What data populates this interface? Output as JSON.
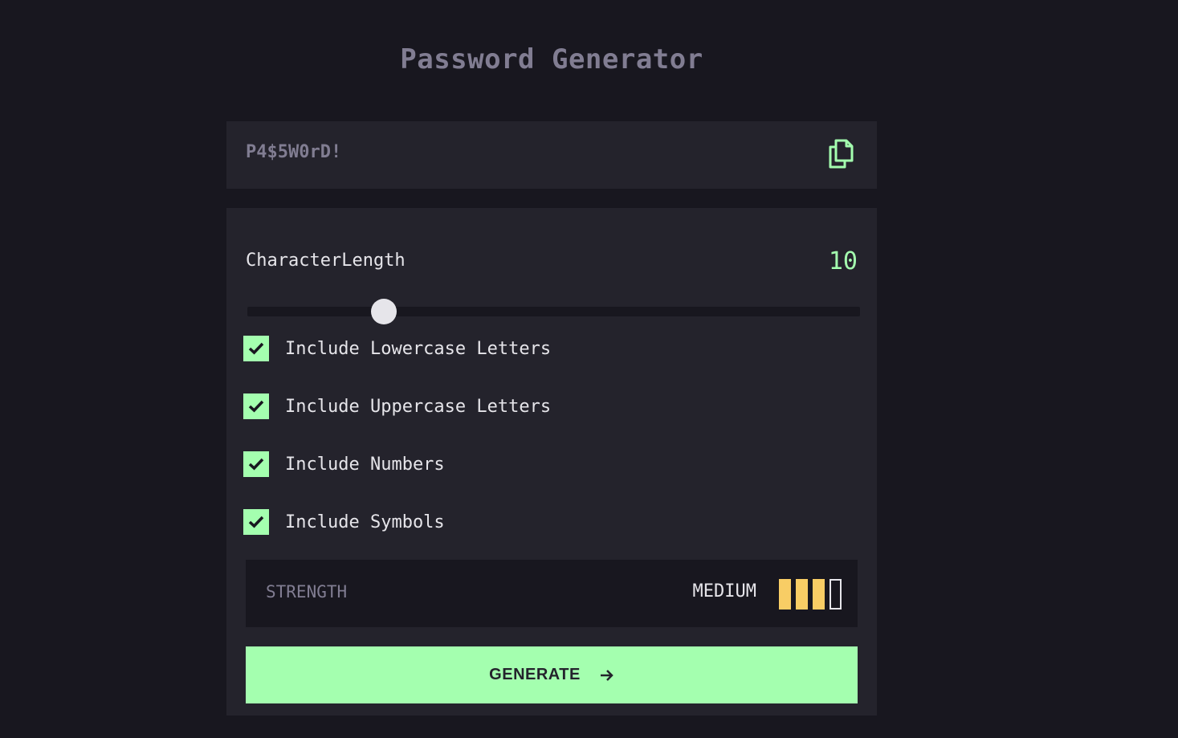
{
  "app": {
    "title": "Password Generator"
  },
  "output": {
    "password": "P4$5W0rD!",
    "copy_icon": "copy-icon"
  },
  "settings": {
    "length_label": "CharacterLength",
    "length_value": "10",
    "options": [
      {
        "label": "Include Lowercase Letters",
        "checked": true
      },
      {
        "label": "Include Uppercase Letters",
        "checked": true
      },
      {
        "label": "Include Numbers",
        "checked": true
      },
      {
        "label": "Include Symbols",
        "checked": true
      }
    ]
  },
  "strength": {
    "label": "STRENGTH",
    "value": "MEDIUM",
    "level": 3,
    "max_level": 4
  },
  "generate": {
    "label": "GENERATE",
    "icon": "arrow-right-icon"
  },
  "colors": {
    "background": "#18171f",
    "panel": "#24232c",
    "accent": "#a4ffaf",
    "strength_medium": "#f8cd65",
    "text": "#e6e5ea",
    "muted": "#817d92"
  }
}
